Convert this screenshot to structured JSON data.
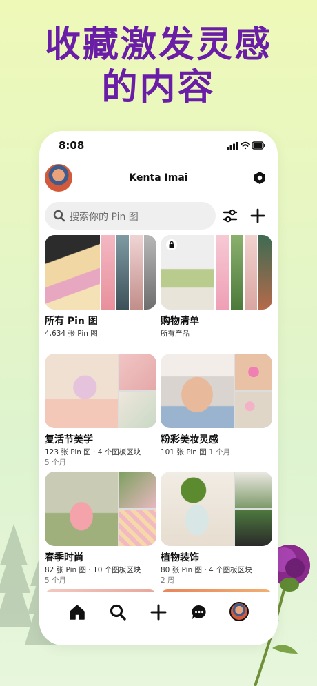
{
  "headline": {
    "line1": "收藏激发灵感",
    "line2": "的内容"
  },
  "status": {
    "time": "8:08"
  },
  "profile": {
    "name": "Kenta Imai"
  },
  "search": {
    "placeholder": "搜索你的 Pin 图"
  },
  "boards": [
    {
      "title": "所有 Pin 图",
      "meta": "4,634 张 Pin 图",
      "extra": "",
      "age": ""
    },
    {
      "title": "购物清单",
      "meta": "所有产品",
      "extra": "",
      "age": ""
    },
    {
      "title": "复活节美学",
      "meta": "123 张 Pin 图 · 4 个图板区块",
      "extra": "",
      "age": "5 个月"
    },
    {
      "title": "粉彩美妆灵感",
      "meta": "101 张 Pin 图",
      "extra": "1 个月",
      "age": ""
    },
    {
      "title": "春季时尚",
      "meta": "82 张 Pin 图 · 10 个图板区块",
      "extra": "",
      "age": "5 个月"
    },
    {
      "title": "植物装饰",
      "meta": "80 张 Pin 图 · 4 个图板区块",
      "extra": "",
      "age": "2 周"
    }
  ],
  "icons": {
    "search": "search-icon",
    "settings": "hexagon-settings-icon",
    "filter": "sliders-icon",
    "add": "plus-icon",
    "lock": "lock-icon",
    "home": "home-icon",
    "explore": "search-icon",
    "create": "plus-icon",
    "messages": "chat-icon"
  },
  "colors": {
    "headline": "#6a1ea8",
    "background": "#e6f6c4"
  }
}
